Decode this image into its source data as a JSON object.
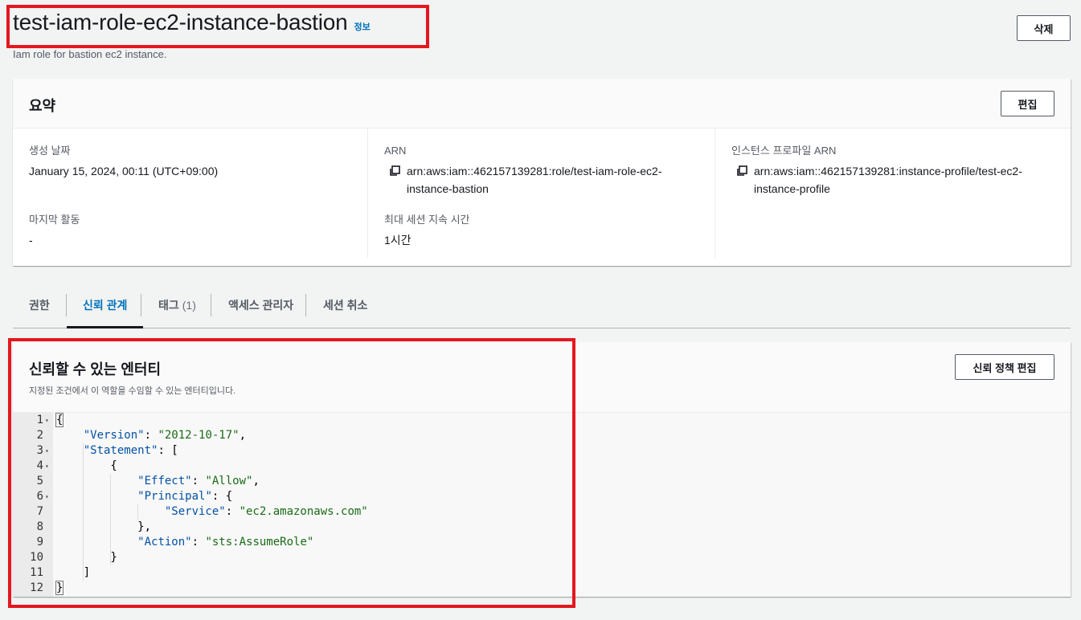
{
  "page": {
    "title": "test-iam-role-ec2-instance-bastion",
    "info_link": "정보",
    "description": "Iam role for bastion ec2 instance.",
    "delete_label": "삭제"
  },
  "summary": {
    "title": "요약",
    "edit_label": "편집",
    "created_label": "생성 날짜",
    "created_value": "January 15, 2024, 00:11 (UTC+09:00)",
    "last_activity_label": "마지막 활동",
    "last_activity_value": "-",
    "arn_label": "ARN",
    "arn_line1": "arn:aws:iam::462157139281:role/test-iam-role-ec2-",
    "arn_line2": "instance-bastion",
    "max_session_label": "최대 세션 지속 시간",
    "max_session_value": "1시간",
    "instance_profile_label": "인스턴스 프로파일 ARN",
    "instance_profile_line1": "arn:aws:iam::462157139281:instance-profile/test-ec2-",
    "instance_profile_line2": "instance-profile"
  },
  "tabs": [
    {
      "label": "권한",
      "count": ""
    },
    {
      "label": "신뢰 관계",
      "count": ""
    },
    {
      "label": "태그",
      "count": "(1)"
    },
    {
      "label": "액세스 관리자",
      "count": ""
    },
    {
      "label": "세션 취소",
      "count": ""
    }
  ],
  "active_tab": "신뢰 관계",
  "trust": {
    "title": "신뢰할 수 있는 엔터티",
    "description": "지정된 조건에서 이 역할을 수임할 수 있는 엔터티입니다.",
    "edit_policy_label": "신뢰 정책 편집"
  },
  "policy": {
    "line_numbers": [
      "1",
      "2",
      "3",
      "4",
      "5",
      "6",
      "7",
      "8",
      "9",
      "10",
      "11",
      "12"
    ],
    "version_key": "\"Version\"",
    "version_value": "\"2012-10-17\"",
    "statement_key": "\"Statement\"",
    "effect_key": "\"Effect\"",
    "effect_value": "\"Allow\"",
    "principal_key": "\"Principal\"",
    "service_key": "\"Service\"",
    "service_value": "\"ec2.amazonaws.com\"",
    "action_key": "\"Action\"",
    "action_value": "\"sts:AssumeRole\""
  },
  "colors": {
    "accent": "#0073bb",
    "highlight": "#e4171f",
    "json_key": "#0451a5",
    "json_string": "#1a6b16"
  }
}
